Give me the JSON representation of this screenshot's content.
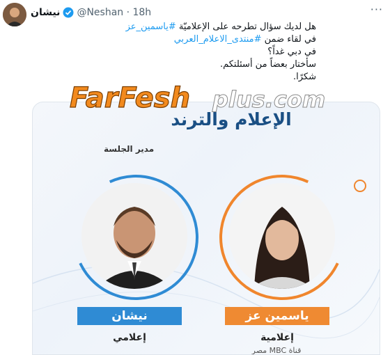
{
  "tweet": {
    "author_name": "نيشان",
    "handle_time": "@Neshan · 18h",
    "more_icon": "more-dots-icon",
    "lines": [
      {
        "text_before": "هل لديك سؤال تطرحه على الإعلاميّة ",
        "hashtag": "#ياسمين_عز"
      },
      {
        "text_before": "في لقاء ضمن ",
        "hashtag": "#منتدى_الاعلام_العربي"
      },
      {
        "text_before": "في دبي غداً؟",
        "hashtag": ""
      },
      {
        "text_before": "سأختار بعضاً من أسئلتكم.",
        "hashtag": ""
      },
      {
        "text_before": "شكرًا.",
        "hashtag": ""
      }
    ]
  },
  "watermark": {
    "brand": "FarFesh",
    "suffix": "plus.com"
  },
  "card": {
    "title": "الإعلام والترند",
    "moderator_label": "مدير الجلسة",
    "left_person": {
      "name": "نيشان",
      "role": "إعلامي"
    },
    "right_person": {
      "name": "ياسمين عز",
      "role": "إعلامية",
      "subrole": "قناة MBC مصر"
    }
  },
  "colors": {
    "blue": "#2f8bd4",
    "orange": "#ef8a32",
    "title": "#1a4f84",
    "link": "#1d9bf0"
  }
}
